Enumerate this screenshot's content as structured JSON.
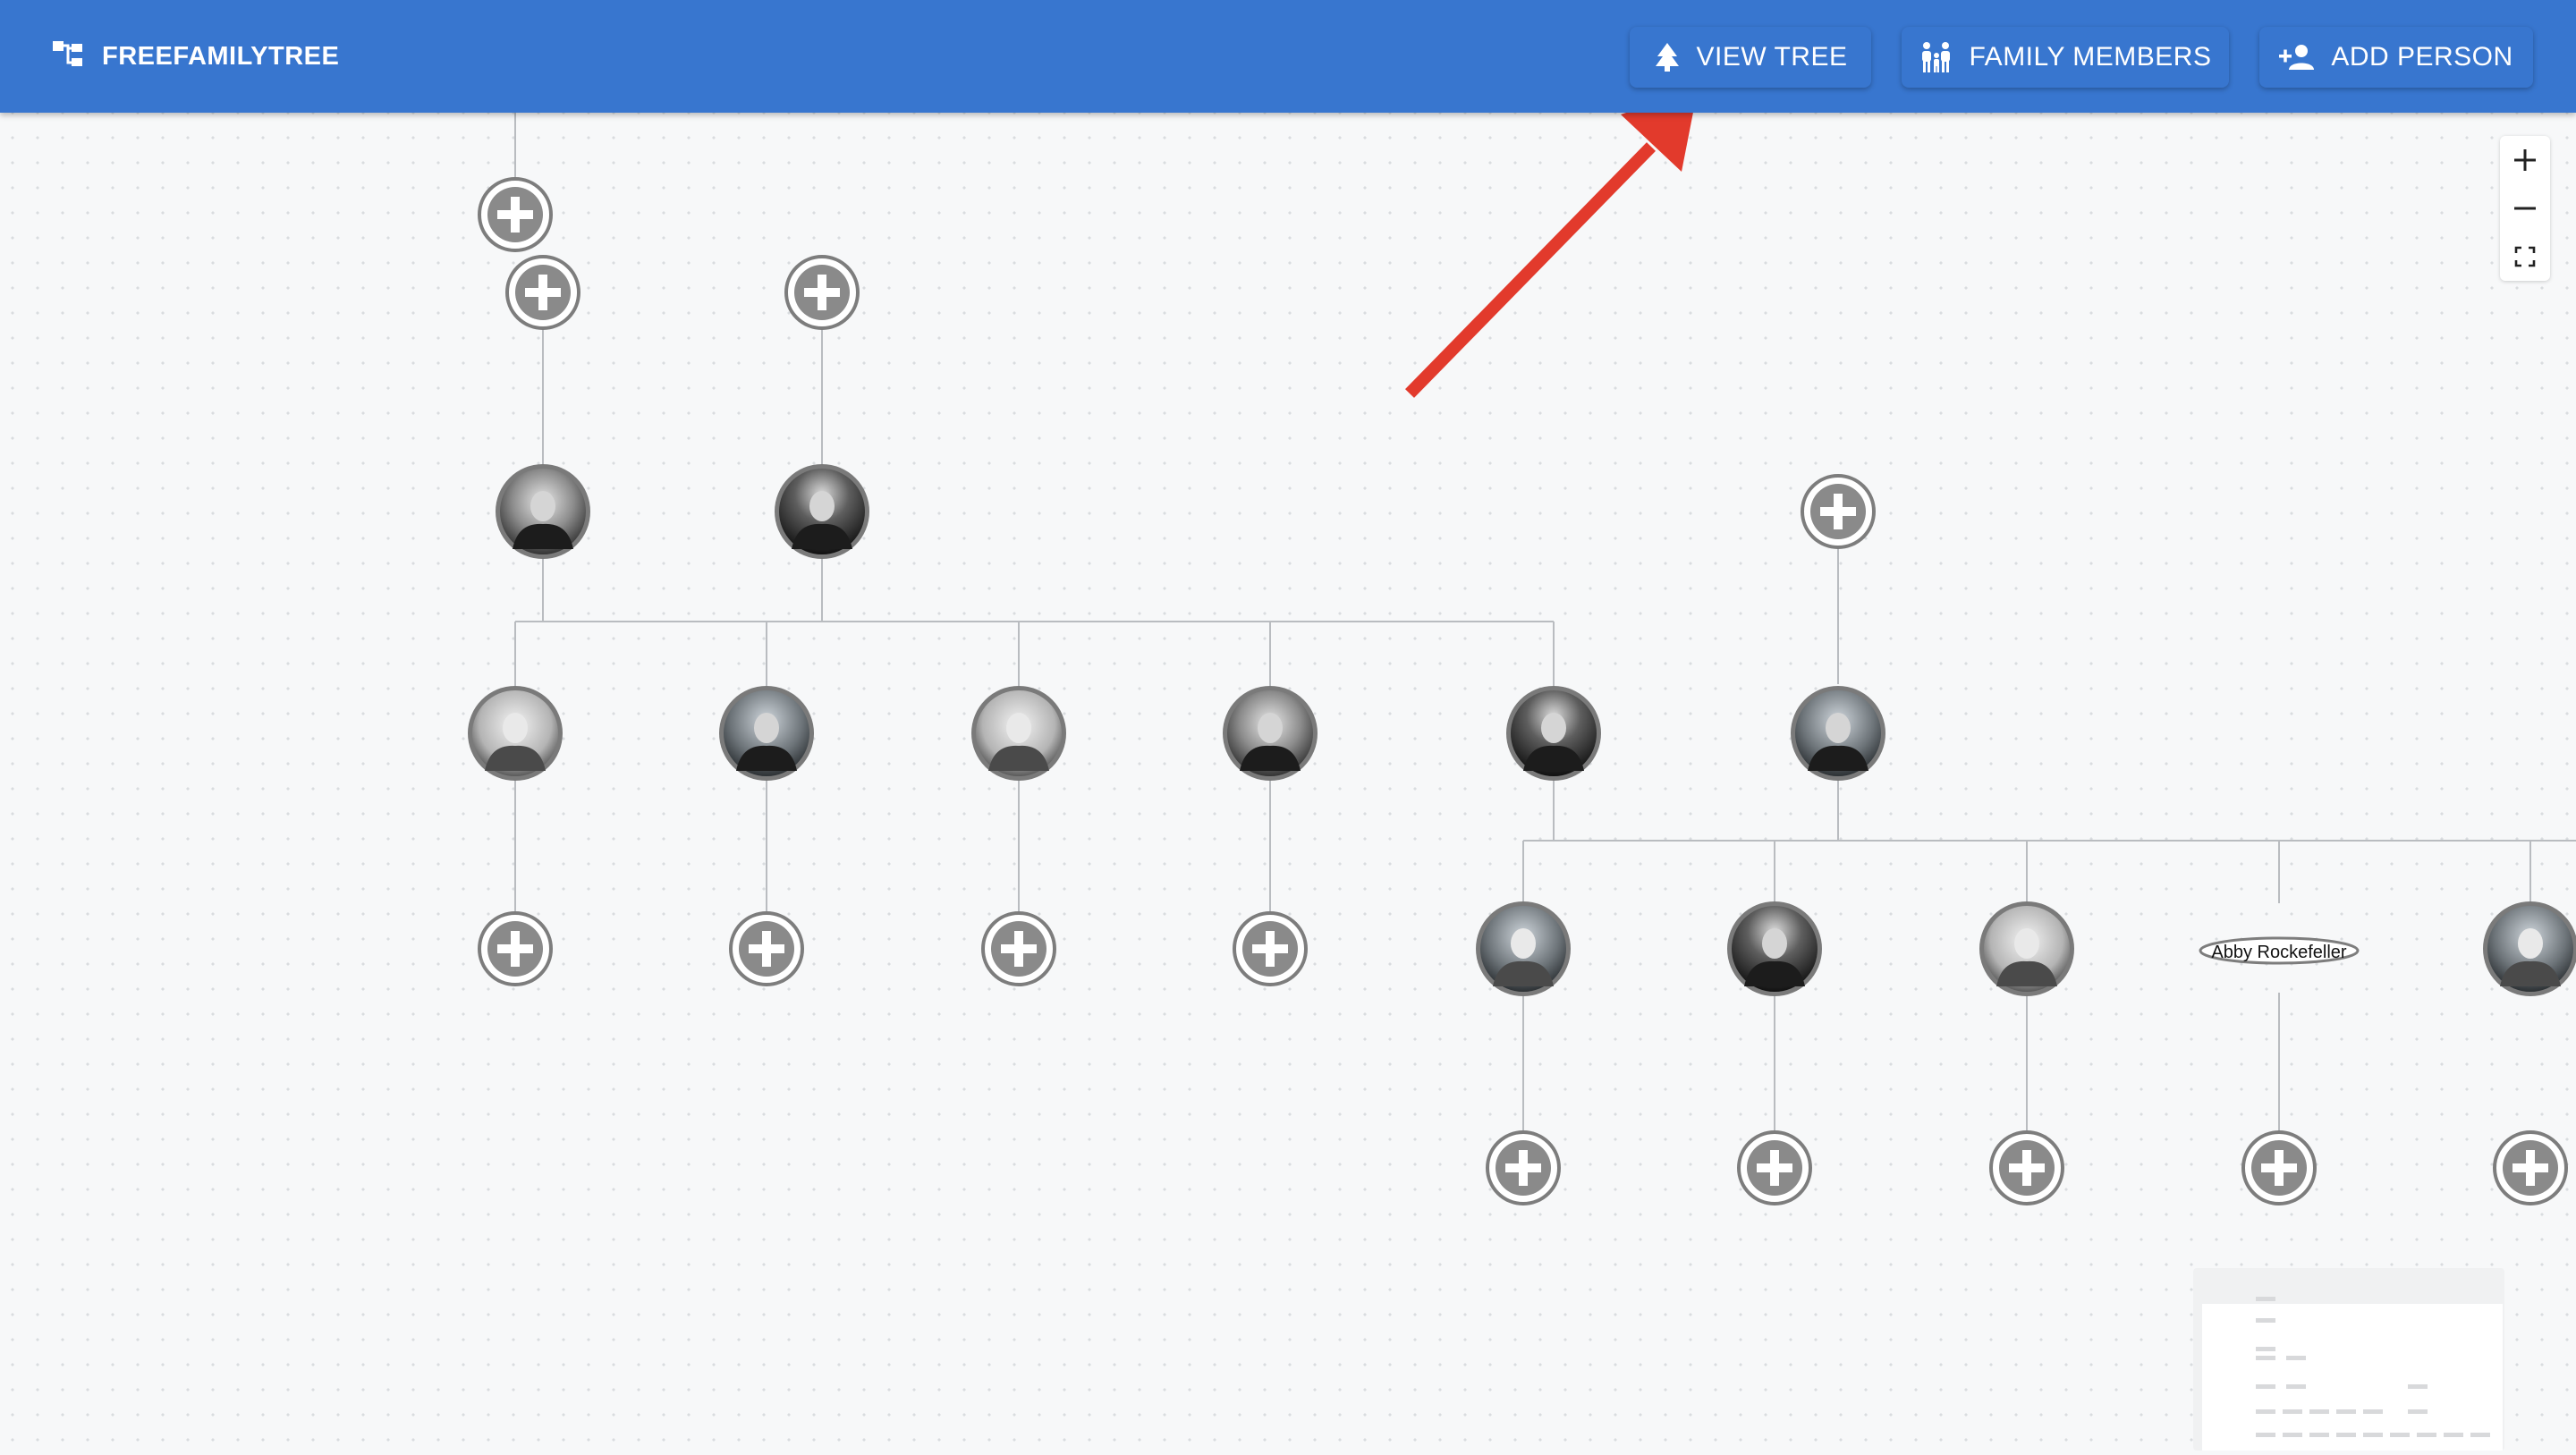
{
  "app": {
    "title": "FREEFAMILYTREE",
    "logo_icon": "family-tree-icon"
  },
  "nav": {
    "view_tree_label": "VIEW TREE",
    "view_tree_icon": "tree-icon",
    "family_members_label": "FAMILY MEMBERS",
    "family_members_icon": "family-icon",
    "add_person_label": "ADD PERSON",
    "add_person_icon": "person-add-icon"
  },
  "zoom_controls": {
    "zoom_in": "+",
    "zoom_out": "−",
    "fit_view_icon": "fit-view-icon"
  },
  "tree": {
    "labeled_node_name": "Abby Rockefeller"
  },
  "colors": {
    "appbar": "#3876cf",
    "annotation_red": "#e23a2c",
    "edge": "#b9bcc0",
    "add_node": "#8a8a8a"
  }
}
